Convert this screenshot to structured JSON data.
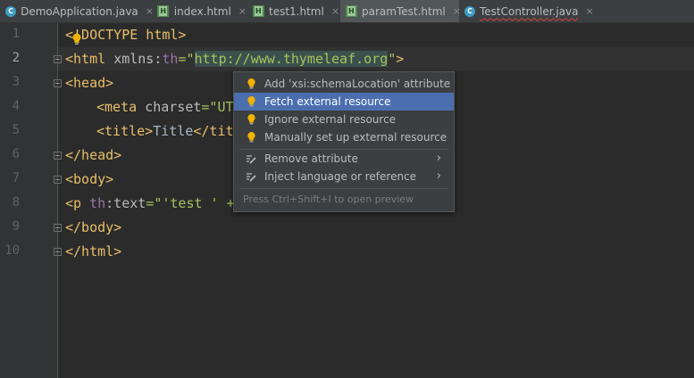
{
  "tabs": [
    {
      "label": "DemoApplication.java",
      "icon": "java-class-icon"
    },
    {
      "label": "index.html",
      "icon": "html-file-icon"
    },
    {
      "label": "test1.html",
      "icon": "html-file-icon"
    },
    {
      "label": "paramTest.html",
      "icon": "html-file-icon",
      "active": true
    },
    {
      "label": "TestController.java",
      "icon": "java-class-icon"
    }
  ],
  "tab_close_glyph": "×",
  "line_numbers": [
    "1",
    "2",
    "3",
    "4",
    "5",
    "6",
    "7",
    "8",
    "9",
    "10"
  ],
  "current_line": 2,
  "code": {
    "l1": {
      "open": "<",
      "rest": "!DOCTYPE html>"
    },
    "l2": {
      "open": "<html ",
      "attr": "xmlns:",
      "ns": "th",
      "eq": "=\"",
      "url": "http://www.thymeleaf.org",
      "close_q": "\"",
      "close": ">"
    },
    "l3": "<head>",
    "l4": {
      "open": "<meta ",
      "attr": "charset",
      "eq": "=\"",
      "val": "UT"
    },
    "l5": {
      "open": "<title>",
      "text": "Title",
      "close": "</tit"
    },
    "l6": "</head>",
    "l7": "<body>",
    "l8": {
      "open": "<p ",
      "ns": "th",
      "attr": ":text",
      "eq": "=\"",
      "val": "'test ' +"
    },
    "l9": "</body>",
    "l10": "</html>"
  },
  "popup": {
    "items": [
      {
        "label": "Add 'xsi:schemaLocation' attribute",
        "icon": "bulb-icon"
      },
      {
        "label": "Fetch external resource",
        "icon": "bulb-icon",
        "selected": true
      },
      {
        "label": "Ignore external resource",
        "icon": "bulb-icon"
      },
      {
        "label": "Manually set up external resource",
        "icon": "bulb-icon"
      }
    ],
    "submenu_items": [
      {
        "label": "Remove attribute",
        "icon": "edit-intention-icon",
        "chevron": "›"
      },
      {
        "label": "Inject language or reference",
        "icon": "edit-intention-icon",
        "chevron": "›"
      }
    ],
    "footer": "Press Ctrl+Shift+I to open preview"
  },
  "colors": {
    "editor_bg": "#2b2b2b",
    "tag": "#e8bf6a",
    "string": "#a5c25c",
    "namespace": "#9876aa",
    "selection": "#4b6eaf"
  }
}
